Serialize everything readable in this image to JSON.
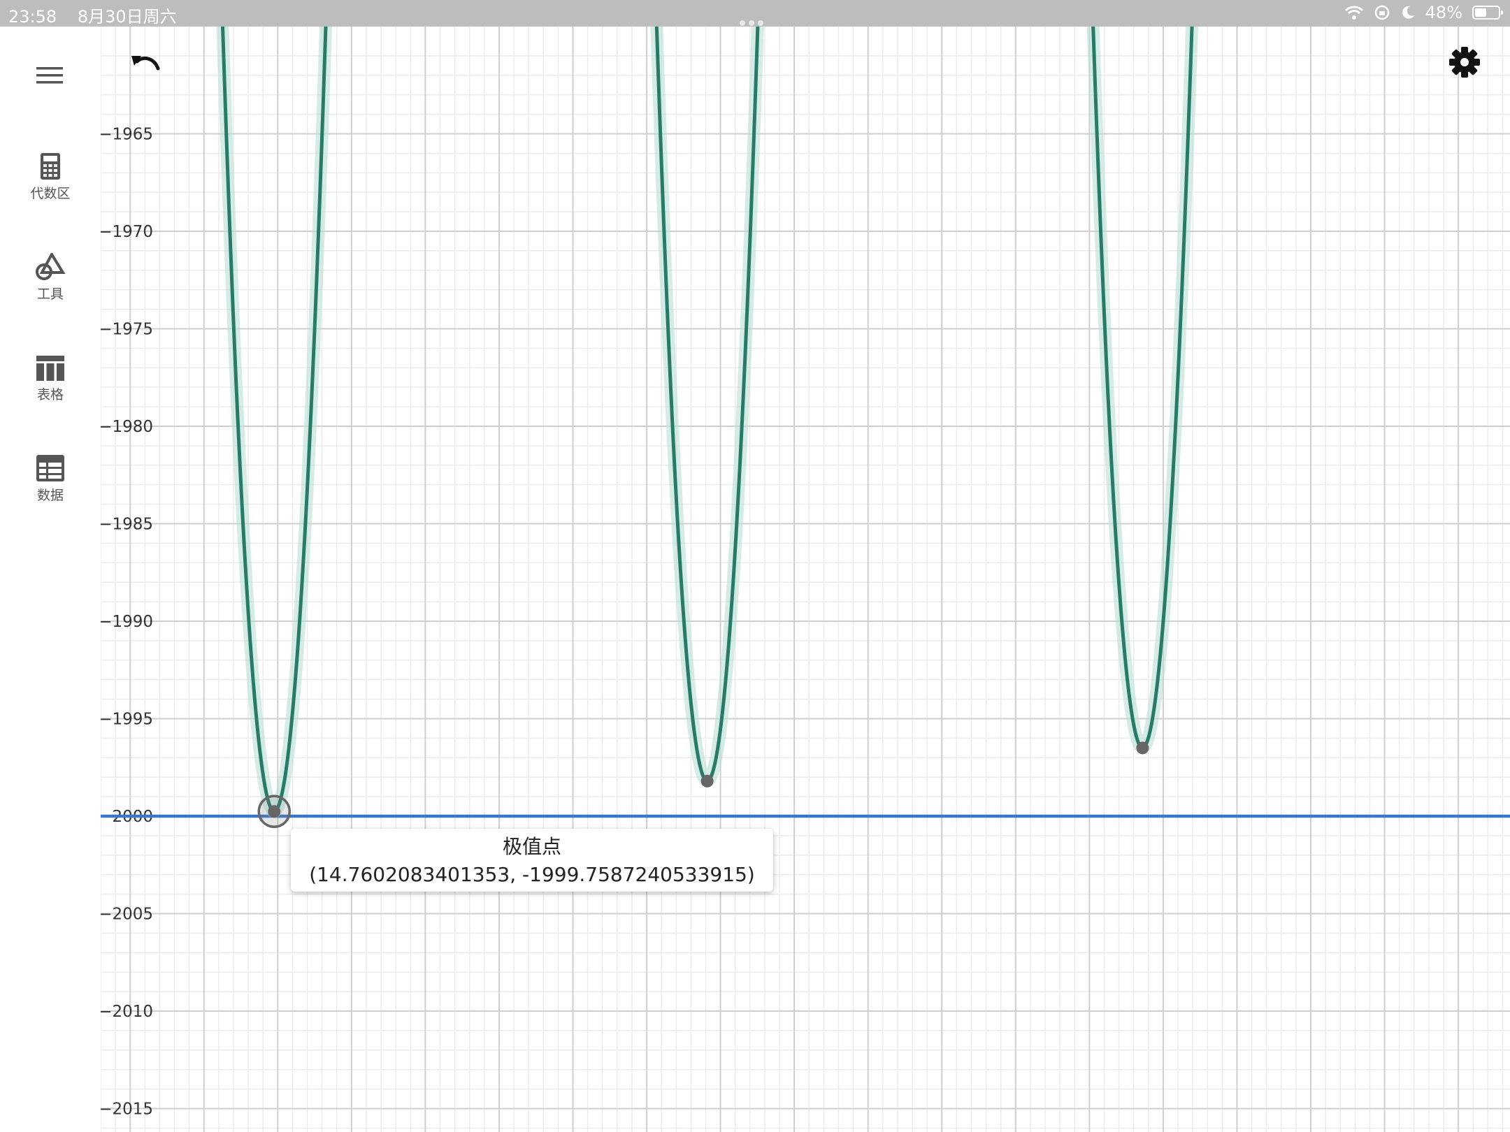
{
  "status_bar": {
    "time": "23:58",
    "date": "8月30日周六",
    "battery": "48%"
  },
  "sidebar": {
    "menu_icon": "hamburger-menu-icon",
    "items": [
      {
        "label": "代数区",
        "icon": "calculator-icon"
      },
      {
        "label": "工具",
        "icon": "geometry-tools-icon"
      },
      {
        "label": "表格",
        "icon": "table-icon"
      },
      {
        "label": "数据",
        "icon": "spreadsheet-icon"
      }
    ]
  },
  "toolbar": {
    "undo_icon": "undo-icon",
    "settings_icon": "gear-icon"
  },
  "colors": {
    "curve": "#2a7a68",
    "curve_halo": "#b9e0d6",
    "line": "#3b78c8",
    "point": "#666666",
    "grid_major": "#cfcfcf",
    "grid_minor": "#ececec"
  },
  "tooltip": {
    "title": "极值点",
    "value": "(14.7602083401353, -1999.7587240533915)"
  },
  "chart_data": {
    "type": "line",
    "x_ticks": [
      5,
      10,
      15,
      20,
      25,
      30,
      35,
      40,
      45,
      50,
      55,
      60,
      65,
      70,
      75,
      80,
      85,
      90,
      95
    ],
    "y_ticks": [
      -1965,
      -1970,
      -1975,
      -1980,
      -1985,
      -1990,
      -1995,
      -2000,
      -2005,
      -2010,
      -2015
    ],
    "xlim": [
      3,
      98.5
    ],
    "ylim": [
      -2016.2,
      -1959.5
    ],
    "horizontal_line": {
      "y": -2000
    },
    "series": [
      {
        "minima": [
          {
            "x": 14.76,
            "y": -1999.76
          },
          {
            "x": 44.1,
            "y": -1998.2
          },
          {
            "x": 73.6,
            "y": -1996.5
          }
        ]
      }
    ],
    "extreme_points": [
      {
        "x": 14.7602083401353,
        "y": -1999.7587240533915,
        "selected": true
      },
      {
        "x": 44.1,
        "y": -1998.2,
        "selected": false
      },
      {
        "x": 73.6,
        "y": -1996.5,
        "selected": false
      }
    ],
    "grid": true
  }
}
